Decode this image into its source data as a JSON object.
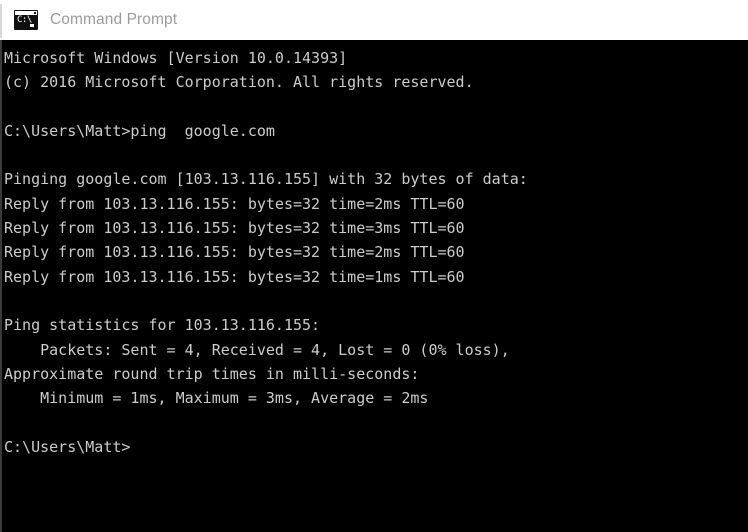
{
  "titlebar": {
    "title": "Command Prompt",
    "icon": "command-prompt-icon",
    "icon_glyph": "C:\\"
  },
  "console": {
    "background_color": "#000000",
    "text_color": "#cccccc",
    "lines": [
      "Microsoft Windows [Version 10.0.14393]",
      "(c) 2016 Microsoft Corporation. All rights reserved.",
      "",
      "C:\\Users\\Matt>ping  google.com",
      "",
      "Pinging google.com [103.13.116.155] with 32 bytes of data:",
      "Reply from 103.13.116.155: bytes=32 time=2ms TTL=60",
      "Reply from 103.13.116.155: bytes=32 time=3ms TTL=60",
      "Reply from 103.13.116.155: bytes=32 time=2ms TTL=60",
      "Reply from 103.13.116.155: bytes=32 time=1ms TTL=60",
      "",
      "Ping statistics for 103.13.116.155:",
      "    Packets: Sent = 4, Received = 4, Lost = 0 (0% loss),",
      "Approximate round trip times in milli-seconds:",
      "    Minimum = 1ms, Maximum = 3ms, Average = 2ms",
      "",
      "C:\\Users\\Matt>"
    ],
    "prompt": "C:\\Users\\Matt>",
    "command": "ping  google.com",
    "host": "google.com",
    "resolved_ip": "103.13.116.155",
    "packet_size": "32",
    "ttl": "60",
    "reply_times": [
      "2ms",
      "3ms",
      "2ms",
      "1ms"
    ],
    "stats": {
      "sent": "4",
      "received": "4",
      "lost": "0",
      "loss_percent": "0%",
      "minimum": "1ms",
      "maximum": "3ms",
      "average": "2ms"
    },
    "os_version": "10.0.14393",
    "copyright_year": "2016"
  }
}
